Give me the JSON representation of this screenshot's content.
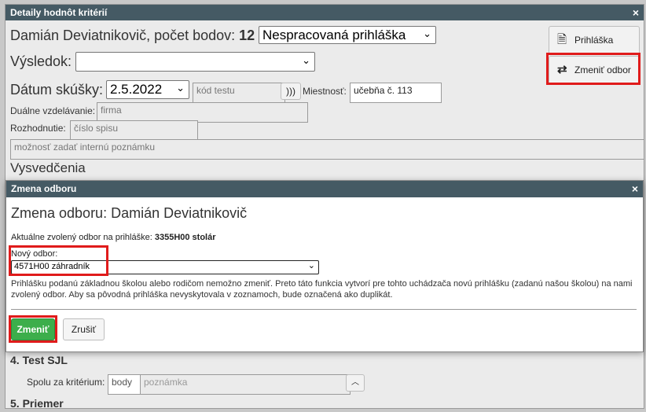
{
  "bg": {
    "title": "Detaily hodnôt kritérií",
    "close_icon": "×",
    "applicant_line": "Damián Deviatnikovič, počet bodov:",
    "points": "12",
    "status_select": "Nespracovaná prihláška",
    "vysledok_label": "Výsledok:",
    "vysledok_value": "",
    "datum_label": "Dátum skúšky:",
    "datum_value": "2.5.2022",
    "test_code_placeholder": "kód testu",
    "miestnost_label": "Miestnosť:",
    "miestnost_value": "učebňa č. 113",
    "dualne_label": "Duálne vzdelávanie:",
    "dualne_placeholder": "firma",
    "rozhodnutie_label": "Rozhodnutie:",
    "rozhodnutie_placeholder": "číslo spisu",
    "note_placeholder": "možnosť zadať internú poznámku",
    "vysvedcenia": "Vysvedčenia",
    "btn_prihlaska": "Prihláška",
    "btn_zmenit_odbor": "Zmeniť odbor",
    "section4": "4. Test SJL",
    "spolu_label": "Spolu za kritérium:",
    "body_placeholder": "body",
    "poznamka_placeholder": "poznámka",
    "section5": "5. Priemer"
  },
  "modal": {
    "title": "Zmena odboru",
    "close_icon": "×",
    "heading": "Zmena odboru: Damián Deviatnikovič",
    "current_label": "Aktuálne zvolený odbor na prihláške:",
    "current_value": "3355H00 stolár",
    "new_label": "Nový odbor:",
    "new_value": "4571H00 záhradník",
    "info_text": "Prihlášku podanú základnou školou alebo rodičom nemožno zmeniť. Preto táto funkcia vytvorí pre tohto uchádzača novú prihlášku (zadanú našou školou) na nami zvolený odbor. Aby sa pôvodná prihláška nevyskytovala v zoznamoch, bude označená ako duplikát.",
    "btn_zmenit": "Zmeniť",
    "btn_zrusit": "Zrušiť"
  },
  "colors": {
    "titlebar": "#455a64",
    "highlight": "#e01b1b",
    "primary": "#3cae4b"
  }
}
